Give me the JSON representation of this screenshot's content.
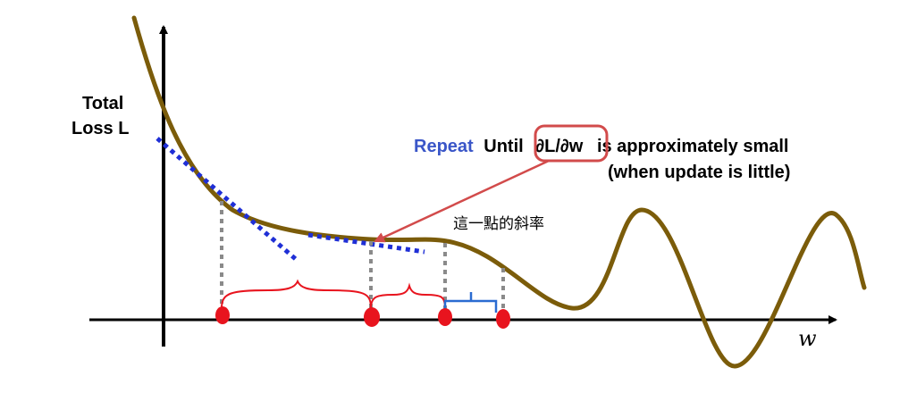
{
  "y_axis_label_line1": "Total",
  "y_axis_label_line2": "Loss L",
  "x_axis_label": "w",
  "annotation": {
    "repeat_word": "Repeat",
    "until_word": "Until",
    "derivative": "∂L/∂w",
    "rest": "is approximately small",
    "line2": "(when update is little)"
  },
  "slope_note": "這一點的斜率",
  "colors": {
    "curve": "#7b5c0a",
    "tangent": "#1f2fd6",
    "points": "#e8141e",
    "brace": "#e8141e",
    "small_bracket": "#2a6bd1",
    "callout": "#d24b4b",
    "repeat_text": "#3a56c8"
  }
}
